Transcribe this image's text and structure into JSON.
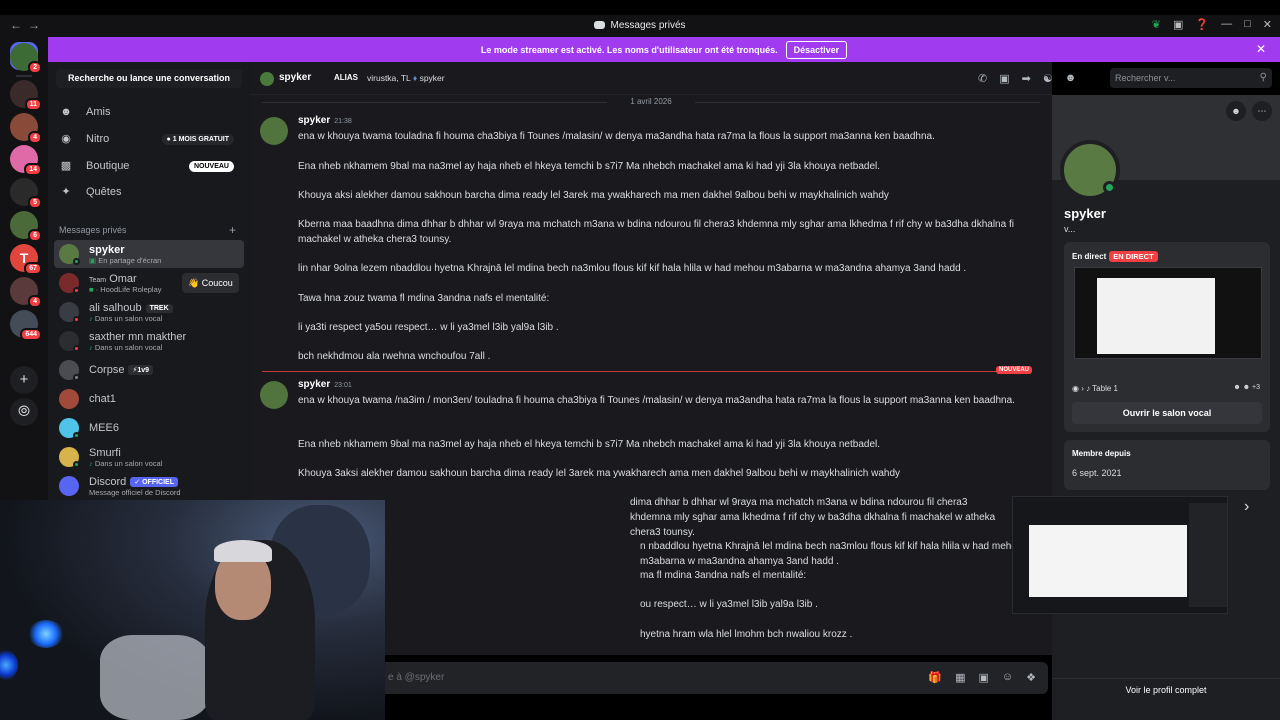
{
  "window": {
    "title": "Messages privés"
  },
  "banner": {
    "text": "Le mode streamer est activé. Les noms d'utilisateur ont été tronqués.",
    "button": "Désactiver"
  },
  "rail": {
    "servers": [
      {
        "badge": "2",
        "color": "#3d6b35"
      },
      {
        "badge": "11",
        "color": "#3a2a2a"
      },
      {
        "badge": "4",
        "color": "#8a4a3a"
      },
      {
        "badge": "14",
        "color": "#e06aa8"
      },
      {
        "badge": "5",
        "color": "#2a2a2a"
      },
      {
        "badge": "6",
        "color": "#4a6a3a"
      },
      {
        "badge": "67",
        "color": "#e0463d",
        "letter": "T"
      },
      {
        "badge": "4",
        "color": "#5a3a3a"
      },
      {
        "badge": "644",
        "color": "#444c58"
      }
    ]
  },
  "sidebar": {
    "search_label": "Recherche ou lance une conversation",
    "nav": [
      {
        "label": "Amis",
        "icon": "friends-icon"
      },
      {
        "label": "Nitro",
        "icon": "nitro-icon",
        "pill": "1 MOIS GRATUIT"
      },
      {
        "label": "Boutique",
        "icon": "shop-icon",
        "pill": "NOUVEAU"
      },
      {
        "label": "Quêtes",
        "icon": "quests-icon"
      }
    ],
    "dm_header": "Messages privés",
    "dms": [
      {
        "name": "spyker",
        "sub": "En partage d'écran"
      },
      {
        "name": "Omar",
        "prefix": "Team",
        "sub": "HoodLife Roleplay"
      },
      {
        "name": "ali salhoub",
        "tag": "TREK",
        "sub": "Dans un salon vocal"
      },
      {
        "name": "saxther mn makther",
        "sub": "Dans un salon vocal"
      },
      {
        "name": "Corpse",
        "tag": "1v9"
      },
      {
        "name": "chat1"
      },
      {
        "name": "MEE6"
      },
      {
        "name": "Smurfi",
        "sub": "Dans un salon vocal"
      },
      {
        "name": "Discord",
        "tag": "OFFICIEL",
        "sub": "Message officiel de Discord"
      }
    ],
    "coucou": "Coucou"
  },
  "header": {
    "username": "spyker",
    "alias_label": "ALIAS",
    "alias_value": "virustka, TL",
    "alias_user": "spyker",
    "search_placeholder": "Rechercher v..."
  },
  "chat": {
    "date": "1 avril 2026",
    "new_label": "NOUVEAU",
    "messages": [
      {
        "author": "spyker",
        "time": "21:38",
        "paragraphs": [
          "ena w khouya twama touladna fi houma cha3biya fi Tounes /malasin/ w denya ma3andha hata ra7ma la flous la support ma3anna ken baadhna.",
          "Ena nheb nkhamem 9bal ma na3mel ay haja nheb el hkeya temchi b s7i7 Ma nhebch machakel ama ki had yji 3la khouya netbadel.",
          "Khouya aksi alekher damou sakhoun barcha dima ready lel 3arek ma ywakharech ma men dakhel 9albou behi w maykhalinich wahdy",
          "Kberna maa baadhna dima dhhar b dhhar wl 9raya ma mchatch m3ana w bdina ndourou fil chera3 khdemna mly sghar ama lkhedma f rif chy w ba3dha dkhalna fi machakel w atheka chera3 tounsy.",
          "lin nhar 9olna lezem nbaddlou hyetna  Khrajnā lel mdina bech na3mlou flous kif kif hala hlila w had mehou m3abarna w ma3andna ahamya 3and hadd .",
          "Tawa hna zouz twama fl mdina 3andna nafs el mentalité:",
          "li ya3ti respect ya5ou respect… w li ya3mel l3ib yal9a l3ib .",
          "bch nekhdmou ala rwehna wnchoufou 7all ."
        ]
      },
      {
        "author": "spyker",
        "time": "23:01",
        "paragraphs": [
          "ena w khouya twama /na3im / mon3en/ touladna fi houma cha3biya fi Tounes /malasin/ w denya ma3andha hata ra7ma la flous la support ma3anna ken baadhna.",
          "Ena nheb nkhamem 9bal ma na3mel ay haja nheb el hkeya temchi b s7i7 Ma nhebch machakel ama ki had yji 3la khouya netbadel.",
          "Khouya 3aksi alekher damou sakhoun barcha dima ready lel 3arek ma ywakharech ama men dakhel 9albou behi w maykhalinich wahdy",
          "dima dhhar b dhhar wl 9raya ma mchatch m3ana w bdina ndourou fil chera3 khdemna mly sghar ama lkhedma f rif chy w ba3dha dkhalna fi machakel w atheka chera3 tounsy.",
          "n nbaddlou hyetna  Khrajnā lel mdina bech na3mlou flous kif kif hala hlila w had mehou m3abarna w ma3andna ahamya 3and hadd .",
          "ma fl mdina 3andna nafs el mentalité:",
          "ou respect… w li ya3mel l3ib yal9a l3ib .",
          "hyetna hram wla hlel lmohm bch nwaliou krozz ."
        ]
      }
    ],
    "composer_placeholder": "e à @spyker"
  },
  "profile": {
    "name": "spyker",
    "pronoun": "v...",
    "live_title": "En direct",
    "live_badge": "EN DIRECT",
    "channel": "Table 1",
    "count": "+3",
    "open_button": "Ouvrir le salon vocal",
    "member_title": "Membre depuis",
    "member_date": "6 sept. 2021",
    "full_profile": "Voir le profil complet"
  }
}
